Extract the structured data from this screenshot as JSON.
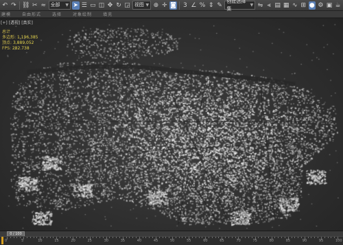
{
  "toolbar": {
    "undo_icon": "undo-icon",
    "redo_icon": "redo-icon",
    "layer_combo": "全部",
    "view_combo": "视图",
    "selection_set_placeholder": "创建选择集",
    "accent": "#5a7fb5"
  },
  "ribbon": {
    "tabs": [
      "建模",
      "自由形式",
      "选择",
      "对象绘制",
      "填充"
    ]
  },
  "viewport": {
    "label": "[+] [透视] [真实]",
    "stats_title": "总计",
    "stats": [
      {
        "key": "多边形:",
        "value": "1,196,385"
      },
      {
        "key": "顶点:",
        "value": "3,889,052"
      },
      {
        "key": "FPS:",
        "value": "282.738"
      }
    ],
    "stats_color": "#e6d54d"
  },
  "timeline": {
    "slider_text": "0 / 100"
  },
  "ruler": {
    "labels": [
      "0",
      "5",
      "10",
      "15",
      "20",
      "25",
      "30",
      "35",
      "40",
      "45",
      "50",
      "55",
      "60",
      "65",
      "70",
      "75",
      "80",
      "85",
      "90",
      "95",
      "100"
    ]
  }
}
